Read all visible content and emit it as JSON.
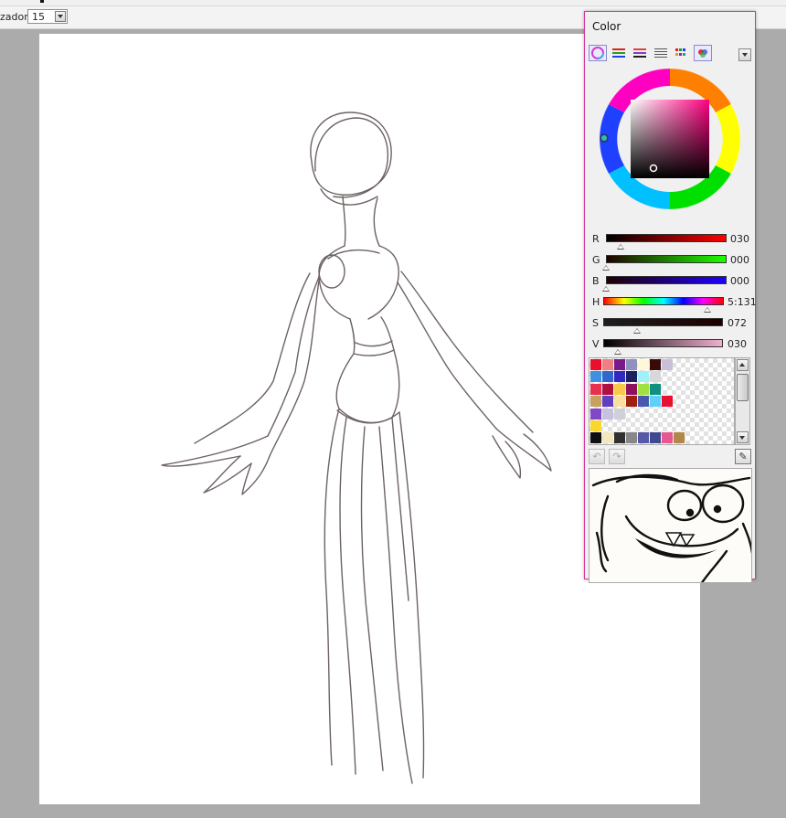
{
  "toolbar": {
    "label": "zador",
    "value": "15"
  },
  "color_panel": {
    "title": "Color",
    "mode_tabs": [
      "color-wheel-tab",
      "rgb-sliders-tab",
      "hsv-sliders-tab",
      "list-tab",
      "swatch-grid-tab",
      "palette-tab"
    ],
    "current_color": "#1e0000",
    "sliders": [
      {
        "label": "R",
        "value": "030",
        "level": 0.118
      },
      {
        "label": "G",
        "value": "000",
        "level": 0.0
      },
      {
        "label": "B",
        "value": "000",
        "level": 0.0
      },
      {
        "label": "H",
        "value": "5:131",
        "level": 0.86
      },
      {
        "label": "S",
        "value": "072",
        "level": 0.28
      },
      {
        "label": "V",
        "value": "030",
        "level": 0.12
      }
    ],
    "swatches": [
      [
        "#e8102a",
        "#f08080",
        "#7a1a8a",
        "#9090c0",
        "#fff8d8",
        "#3a0a0a",
        "#c8c0d8"
      ],
      [
        "#4090e0",
        "#3068d0",
        "#3028c0",
        "#1a2060",
        "#a0f0f8",
        "#d8d8d8"
      ],
      [
        "#e83050",
        "#b01040",
        "#f8c848",
        "#901060",
        "#a0e040",
        "#109080"
      ],
      [
        "#c8a060",
        "#6040c0",
        "#f8e0a0",
        "#a02010",
        "#4858b0",
        "#60d0f8",
        "#e81030"
      ],
      [
        "#8048c8",
        "#c8c0e0",
        "#d0d0d8"
      ],
      [
        "#f8d830"
      ],
      [
        "#101010",
        "#f0e8c0",
        "#303030",
        "#888888",
        "#5858a8",
        "#404890",
        "#e85890",
        "#b08848"
      ]
    ]
  }
}
